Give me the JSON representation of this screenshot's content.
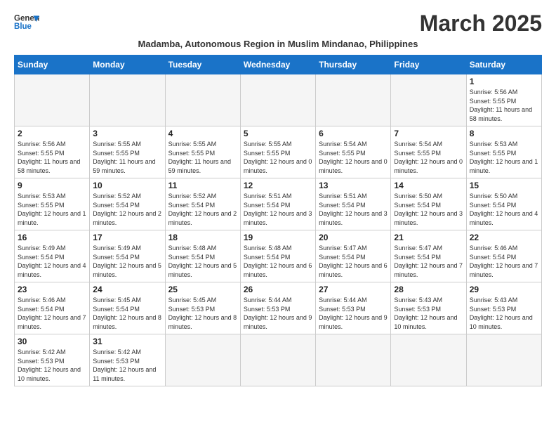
{
  "header": {
    "logo_general": "General",
    "logo_blue": "Blue",
    "month_title": "March 2025",
    "subtitle": "Madamba, Autonomous Region in Muslim Mindanao, Philippines"
  },
  "days_of_week": [
    "Sunday",
    "Monday",
    "Tuesday",
    "Wednesday",
    "Thursday",
    "Friday",
    "Saturday"
  ],
  "weeks": [
    [
      {
        "day": "",
        "info": ""
      },
      {
        "day": "",
        "info": ""
      },
      {
        "day": "",
        "info": ""
      },
      {
        "day": "",
        "info": ""
      },
      {
        "day": "",
        "info": ""
      },
      {
        "day": "",
        "info": ""
      },
      {
        "day": "1",
        "info": "Sunrise: 5:56 AM\nSunset: 5:55 PM\nDaylight: 11 hours\nand 58 minutes."
      }
    ],
    [
      {
        "day": "2",
        "info": "Sunrise: 5:56 AM\nSunset: 5:55 PM\nDaylight: 11 hours\nand 58 minutes."
      },
      {
        "day": "3",
        "info": "Sunrise: 5:55 AM\nSunset: 5:55 PM\nDaylight: 11 hours\nand 59 minutes."
      },
      {
        "day": "4",
        "info": "Sunrise: 5:55 AM\nSunset: 5:55 PM\nDaylight: 11 hours\nand 59 minutes."
      },
      {
        "day": "5",
        "info": "Sunrise: 5:55 AM\nSunset: 5:55 PM\nDaylight: 12 hours\nand 0 minutes."
      },
      {
        "day": "6",
        "info": "Sunrise: 5:54 AM\nSunset: 5:55 PM\nDaylight: 12 hours\nand 0 minutes."
      },
      {
        "day": "7",
        "info": "Sunrise: 5:54 AM\nSunset: 5:55 PM\nDaylight: 12 hours\nand 0 minutes."
      },
      {
        "day": "8",
        "info": "Sunrise: 5:53 AM\nSunset: 5:55 PM\nDaylight: 12 hours\nand 1 minute."
      }
    ],
    [
      {
        "day": "9",
        "info": "Sunrise: 5:53 AM\nSunset: 5:55 PM\nDaylight: 12 hours\nand 1 minute."
      },
      {
        "day": "10",
        "info": "Sunrise: 5:52 AM\nSunset: 5:54 PM\nDaylight: 12 hours\nand 2 minutes."
      },
      {
        "day": "11",
        "info": "Sunrise: 5:52 AM\nSunset: 5:54 PM\nDaylight: 12 hours\nand 2 minutes."
      },
      {
        "day": "12",
        "info": "Sunrise: 5:51 AM\nSunset: 5:54 PM\nDaylight: 12 hours\nand 3 minutes."
      },
      {
        "day": "13",
        "info": "Sunrise: 5:51 AM\nSunset: 5:54 PM\nDaylight: 12 hours\nand 3 minutes."
      },
      {
        "day": "14",
        "info": "Sunrise: 5:50 AM\nSunset: 5:54 PM\nDaylight: 12 hours\nand 3 minutes."
      },
      {
        "day": "15",
        "info": "Sunrise: 5:50 AM\nSunset: 5:54 PM\nDaylight: 12 hours\nand 4 minutes."
      }
    ],
    [
      {
        "day": "16",
        "info": "Sunrise: 5:49 AM\nSunset: 5:54 PM\nDaylight: 12 hours\nand 4 minutes."
      },
      {
        "day": "17",
        "info": "Sunrise: 5:49 AM\nSunset: 5:54 PM\nDaylight: 12 hours\nand 5 minutes."
      },
      {
        "day": "18",
        "info": "Sunrise: 5:48 AM\nSunset: 5:54 PM\nDaylight: 12 hours\nand 5 minutes."
      },
      {
        "day": "19",
        "info": "Sunrise: 5:48 AM\nSunset: 5:54 PM\nDaylight: 12 hours\nand 6 minutes."
      },
      {
        "day": "20",
        "info": "Sunrise: 5:47 AM\nSunset: 5:54 PM\nDaylight: 12 hours\nand 6 minutes."
      },
      {
        "day": "21",
        "info": "Sunrise: 5:47 AM\nSunset: 5:54 PM\nDaylight: 12 hours\nand 7 minutes."
      },
      {
        "day": "22",
        "info": "Sunrise: 5:46 AM\nSunset: 5:54 PM\nDaylight: 12 hours\nand 7 minutes."
      }
    ],
    [
      {
        "day": "23",
        "info": "Sunrise: 5:46 AM\nSunset: 5:54 PM\nDaylight: 12 hours\nand 7 minutes."
      },
      {
        "day": "24",
        "info": "Sunrise: 5:45 AM\nSunset: 5:54 PM\nDaylight: 12 hours\nand 8 minutes."
      },
      {
        "day": "25",
        "info": "Sunrise: 5:45 AM\nSunset: 5:53 PM\nDaylight: 12 hours\nand 8 minutes."
      },
      {
        "day": "26",
        "info": "Sunrise: 5:44 AM\nSunset: 5:53 PM\nDaylight: 12 hours\nand 9 minutes."
      },
      {
        "day": "27",
        "info": "Sunrise: 5:44 AM\nSunset: 5:53 PM\nDaylight: 12 hours\nand 9 minutes."
      },
      {
        "day": "28",
        "info": "Sunrise: 5:43 AM\nSunset: 5:53 PM\nDaylight: 12 hours\nand 10 minutes."
      },
      {
        "day": "29",
        "info": "Sunrise: 5:43 AM\nSunset: 5:53 PM\nDaylight: 12 hours\nand 10 minutes."
      }
    ],
    [
      {
        "day": "30",
        "info": "Sunrise: 5:42 AM\nSunset: 5:53 PM\nDaylight: 12 hours\nand 10 minutes."
      },
      {
        "day": "31",
        "info": "Sunrise: 5:42 AM\nSunset: 5:53 PM\nDaylight: 12 hours\nand 11 minutes."
      },
      {
        "day": "",
        "info": ""
      },
      {
        "day": "",
        "info": ""
      },
      {
        "day": "",
        "info": ""
      },
      {
        "day": "",
        "info": ""
      },
      {
        "day": "",
        "info": ""
      }
    ]
  ]
}
